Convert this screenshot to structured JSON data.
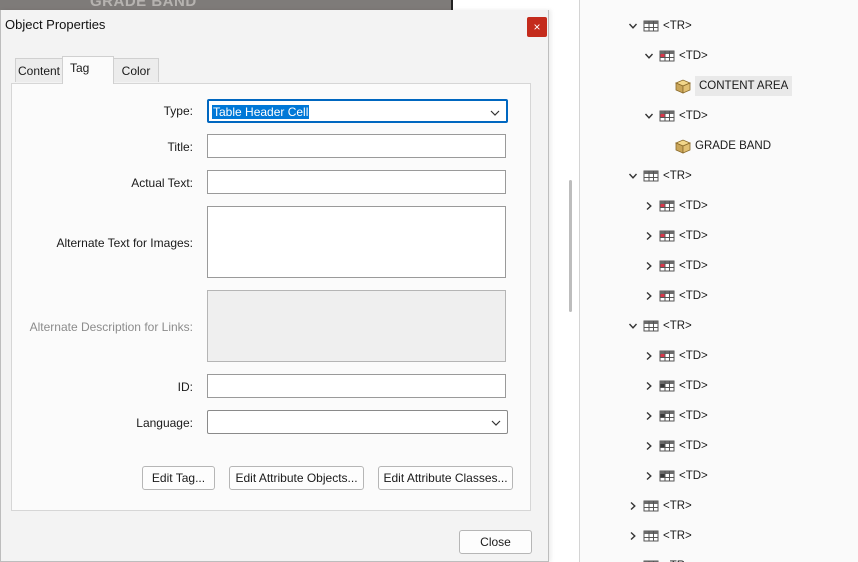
{
  "background": {
    "document_strip_text": "GRADE BAND"
  },
  "dialog": {
    "title": "Object Properties",
    "close_x": "×",
    "tabs": [
      {
        "label": "Content",
        "active": false
      },
      {
        "label": "Tag",
        "active": true
      },
      {
        "label": "Color",
        "active": false
      }
    ],
    "fields": {
      "type_label": "Type:",
      "type_value": "Table Header Cell",
      "title_label": "Title:",
      "title_value": "",
      "actual_text_label": "Actual Text:",
      "actual_text_value": "",
      "alt_text_label": "Alternate Text for Images:",
      "alt_text_value": "",
      "alt_desc_label": "Alternate Description for Links:",
      "alt_desc_value": "",
      "id_label": "ID:",
      "id_value": "",
      "language_label": "Language:",
      "language_value": ""
    },
    "buttons": {
      "edit_tag": "Edit Tag...",
      "edit_attr_objects": "Edit Attribute Objects...",
      "edit_attr_classes": "Edit Attribute Classes...",
      "close": "Close"
    }
  },
  "tags_tree": {
    "rows": [
      {
        "label": "<TR>",
        "icon": "table-row-icon",
        "chevron": "expanded"
      },
      {
        "label": "<TD>",
        "icon": "table-cell-icon",
        "chevron": "expanded"
      },
      {
        "label": "CONTENT AREA",
        "icon": "content-box-icon",
        "chevron": "none",
        "selected": true
      },
      {
        "label": "<TD>",
        "icon": "table-cell-icon",
        "chevron": "expanded"
      },
      {
        "label": "GRADE BAND",
        "icon": "content-box-icon",
        "chevron": "none"
      },
      {
        "label": "<TR>",
        "icon": "table-row-icon",
        "chevron": "expanded"
      },
      {
        "label": "<TD>",
        "icon": "table-cell-icon",
        "chevron": "collapsed"
      },
      {
        "label": "<TD>",
        "icon": "table-cell-icon",
        "chevron": "collapsed"
      },
      {
        "label": "<TD>",
        "icon": "table-cell-icon",
        "chevron": "collapsed"
      },
      {
        "label": "<TD>",
        "icon": "table-cell-icon",
        "chevron": "collapsed"
      },
      {
        "label": "<TR>",
        "icon": "table-row-icon",
        "chevron": "expanded"
      },
      {
        "label": "<TD>",
        "icon": "table-cell-icon",
        "chevron": "collapsed"
      },
      {
        "label": "<TD>",
        "icon": "table-cell-plain-icon",
        "chevron": "collapsed"
      },
      {
        "label": "<TD>",
        "icon": "table-cell-plain-icon",
        "chevron": "collapsed"
      },
      {
        "label": "<TD>",
        "icon": "table-cell-plain-icon",
        "chevron": "collapsed"
      },
      {
        "label": "<TD>",
        "icon": "table-cell-plain-icon",
        "chevron": "collapsed"
      },
      {
        "label": "<TR>",
        "icon": "table-row-icon",
        "chevron": "collapsed"
      },
      {
        "label": "<TR>",
        "icon": "table-row-icon",
        "chevron": "collapsed"
      },
      {
        "label": "<TR>",
        "icon": "table-row-icon",
        "chevron": "collapsed"
      }
    ]
  },
  "colors": {
    "close_red": "#c42b1c",
    "selection_blue": "#0078d7",
    "focus_border": "#0067c0"
  }
}
